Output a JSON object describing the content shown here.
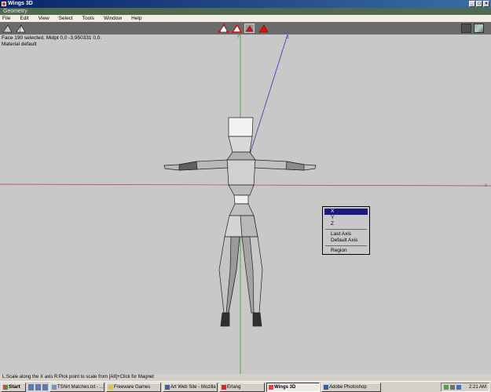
{
  "window": {
    "title": "Wings 3D",
    "subtitle": "Geometry"
  },
  "menu": [
    "File",
    "Edit",
    "View",
    "Select",
    "Tools",
    "Window",
    "Help"
  ],
  "axes": {
    "x": "x",
    "y": "y",
    "z": "z"
  },
  "viewport": {
    "info_line1": "Face 190 selected, Midpt 0,0 -3,950331 0,0.",
    "info_line2": "Material default"
  },
  "context_menu": {
    "items": [
      "X",
      "Y",
      "Z",
      "Last Axis",
      "Default Axis",
      "Region"
    ],
    "highlighted": "X"
  },
  "statusbar": {
    "text": "L:Scale along the X axis   R:Pick point to scale from   [Alt]+Click for Magnet"
  },
  "taskbar": {
    "start": "Start",
    "tasks": [
      "TShirt Matches.txt - ...",
      "Freeware Games",
      "Art Web Site - Mozilla",
      "Erlang",
      "Wings 3D",
      "Adobe Photoshop"
    ],
    "active_task": "Wings 3D",
    "clock": "2:21 AM"
  },
  "colors": {
    "titlebar": "#0a246a",
    "geometry_bar": "#4f6a4f",
    "viewport_bg": "#c8c8c8",
    "menu_highlight": "#1a1a80",
    "x_axis": "#b04040",
    "y_axis": "#3a9a3a",
    "z_axis": "#2a3ab0"
  }
}
